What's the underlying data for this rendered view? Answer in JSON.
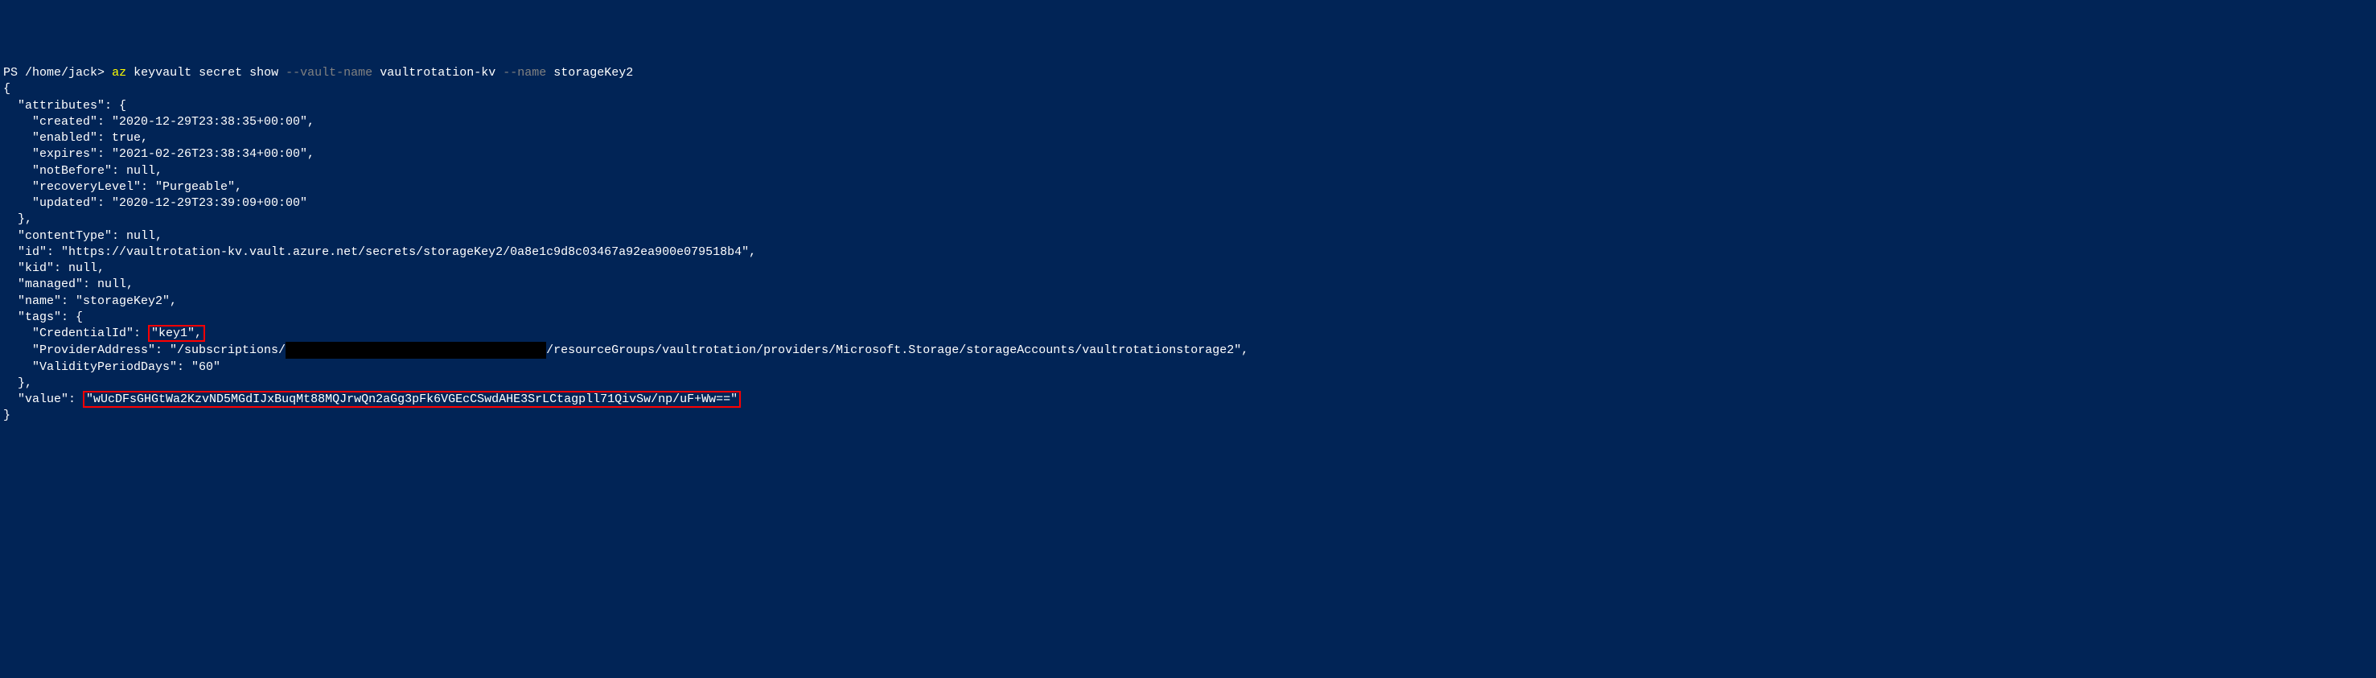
{
  "prompt": {
    "ps": "PS",
    "path": "/home/jack>",
    "cmd": "az",
    "subcmd": "keyvault secret show",
    "flag1": "--vault-name",
    "val1": "vaultrotation-kv",
    "flag2": "--name",
    "val2": "storageKey2"
  },
  "output": {
    "brace_open": "{",
    "attributes_key": "  \"attributes\": {",
    "created": "    \"created\": \"2020-12-29T23:38:35+00:00\",",
    "enabled": "    \"enabled\": true,",
    "expires": "    \"expires\": \"2021-02-26T23:38:34+00:00\",",
    "notBefore": "    \"notBefore\": null,",
    "recoveryLevel": "    \"recoveryLevel\": \"Purgeable\",",
    "updated": "    \"updated\": \"2020-12-29T23:39:09+00:00\"",
    "attributes_close": "  },",
    "contentType": "  \"contentType\": null,",
    "id": "  \"id\": \"https://vaultrotation-kv.vault.azure.net/secrets/storageKey2/0a8e1c9d8c03467a92ea900e079518b4\",",
    "kid": "  \"kid\": null,",
    "managed": "  \"managed\": null,",
    "name": "  \"name\": \"storageKey2\",",
    "tags_key": "  \"tags\": {",
    "credentialId_label": "    \"CredentialId\": ",
    "credentialId_value": "\"key1\",",
    "providerAddress_pre": "    \"ProviderAddress\": \"/subscriptions/",
    "providerAddress_redacted": "                                    ",
    "providerAddress_post": "/resourceGroups/vaultrotation/providers/Microsoft.Storage/storageAccounts/vaultrotationstorage2\",",
    "validityPeriodDays": "    \"ValidityPeriodDays\": \"60\"",
    "tags_close": "  },",
    "value_label": "  \"value\": ",
    "value_content": "\"wUcDFsGHGtWa2KzvND5MGdIJxBuqMt88MQJrwQn2aGg3pFk6VGEcCSwdAHE3SrLCtagpll71QivSw/np/uF+Ww==\"",
    "brace_close": "}"
  }
}
